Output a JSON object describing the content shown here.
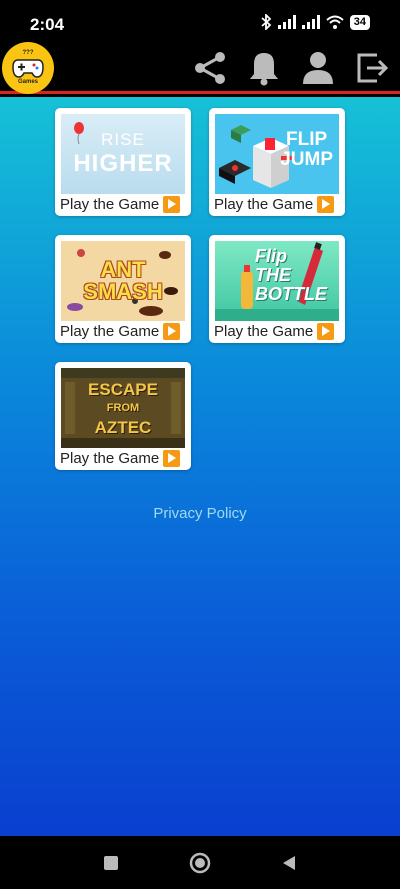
{
  "status_bar": {
    "time": "2:04",
    "battery": "34"
  },
  "header": {
    "logo_text_top": "???",
    "logo_text_bottom": "Games"
  },
  "games": [
    {
      "title_line1": "RISE",
      "title_line2": "HIGHER",
      "cta": "Play the Game"
    },
    {
      "title_line1": "FLIP",
      "title_line2": "JUMP",
      "cta": "Play the Game"
    },
    {
      "title_line1": "ANT",
      "title_line2": "SMASH",
      "cta": "Play the Game"
    },
    {
      "title_line1": "Flip",
      "title_line2": "THE",
      "title_line3": "BOTTLE",
      "cta": "Play the Game"
    },
    {
      "title_line1": "ESCAPE",
      "title_line2": "FROM",
      "title_line3": "AZTEC",
      "cta": "Play the Game"
    }
  ],
  "footer": {
    "privacy": "Privacy Policy"
  },
  "colors": {
    "accent_red": "#d82424",
    "play_orange": "#f59a12",
    "logo_yellow": "#f9c512"
  }
}
